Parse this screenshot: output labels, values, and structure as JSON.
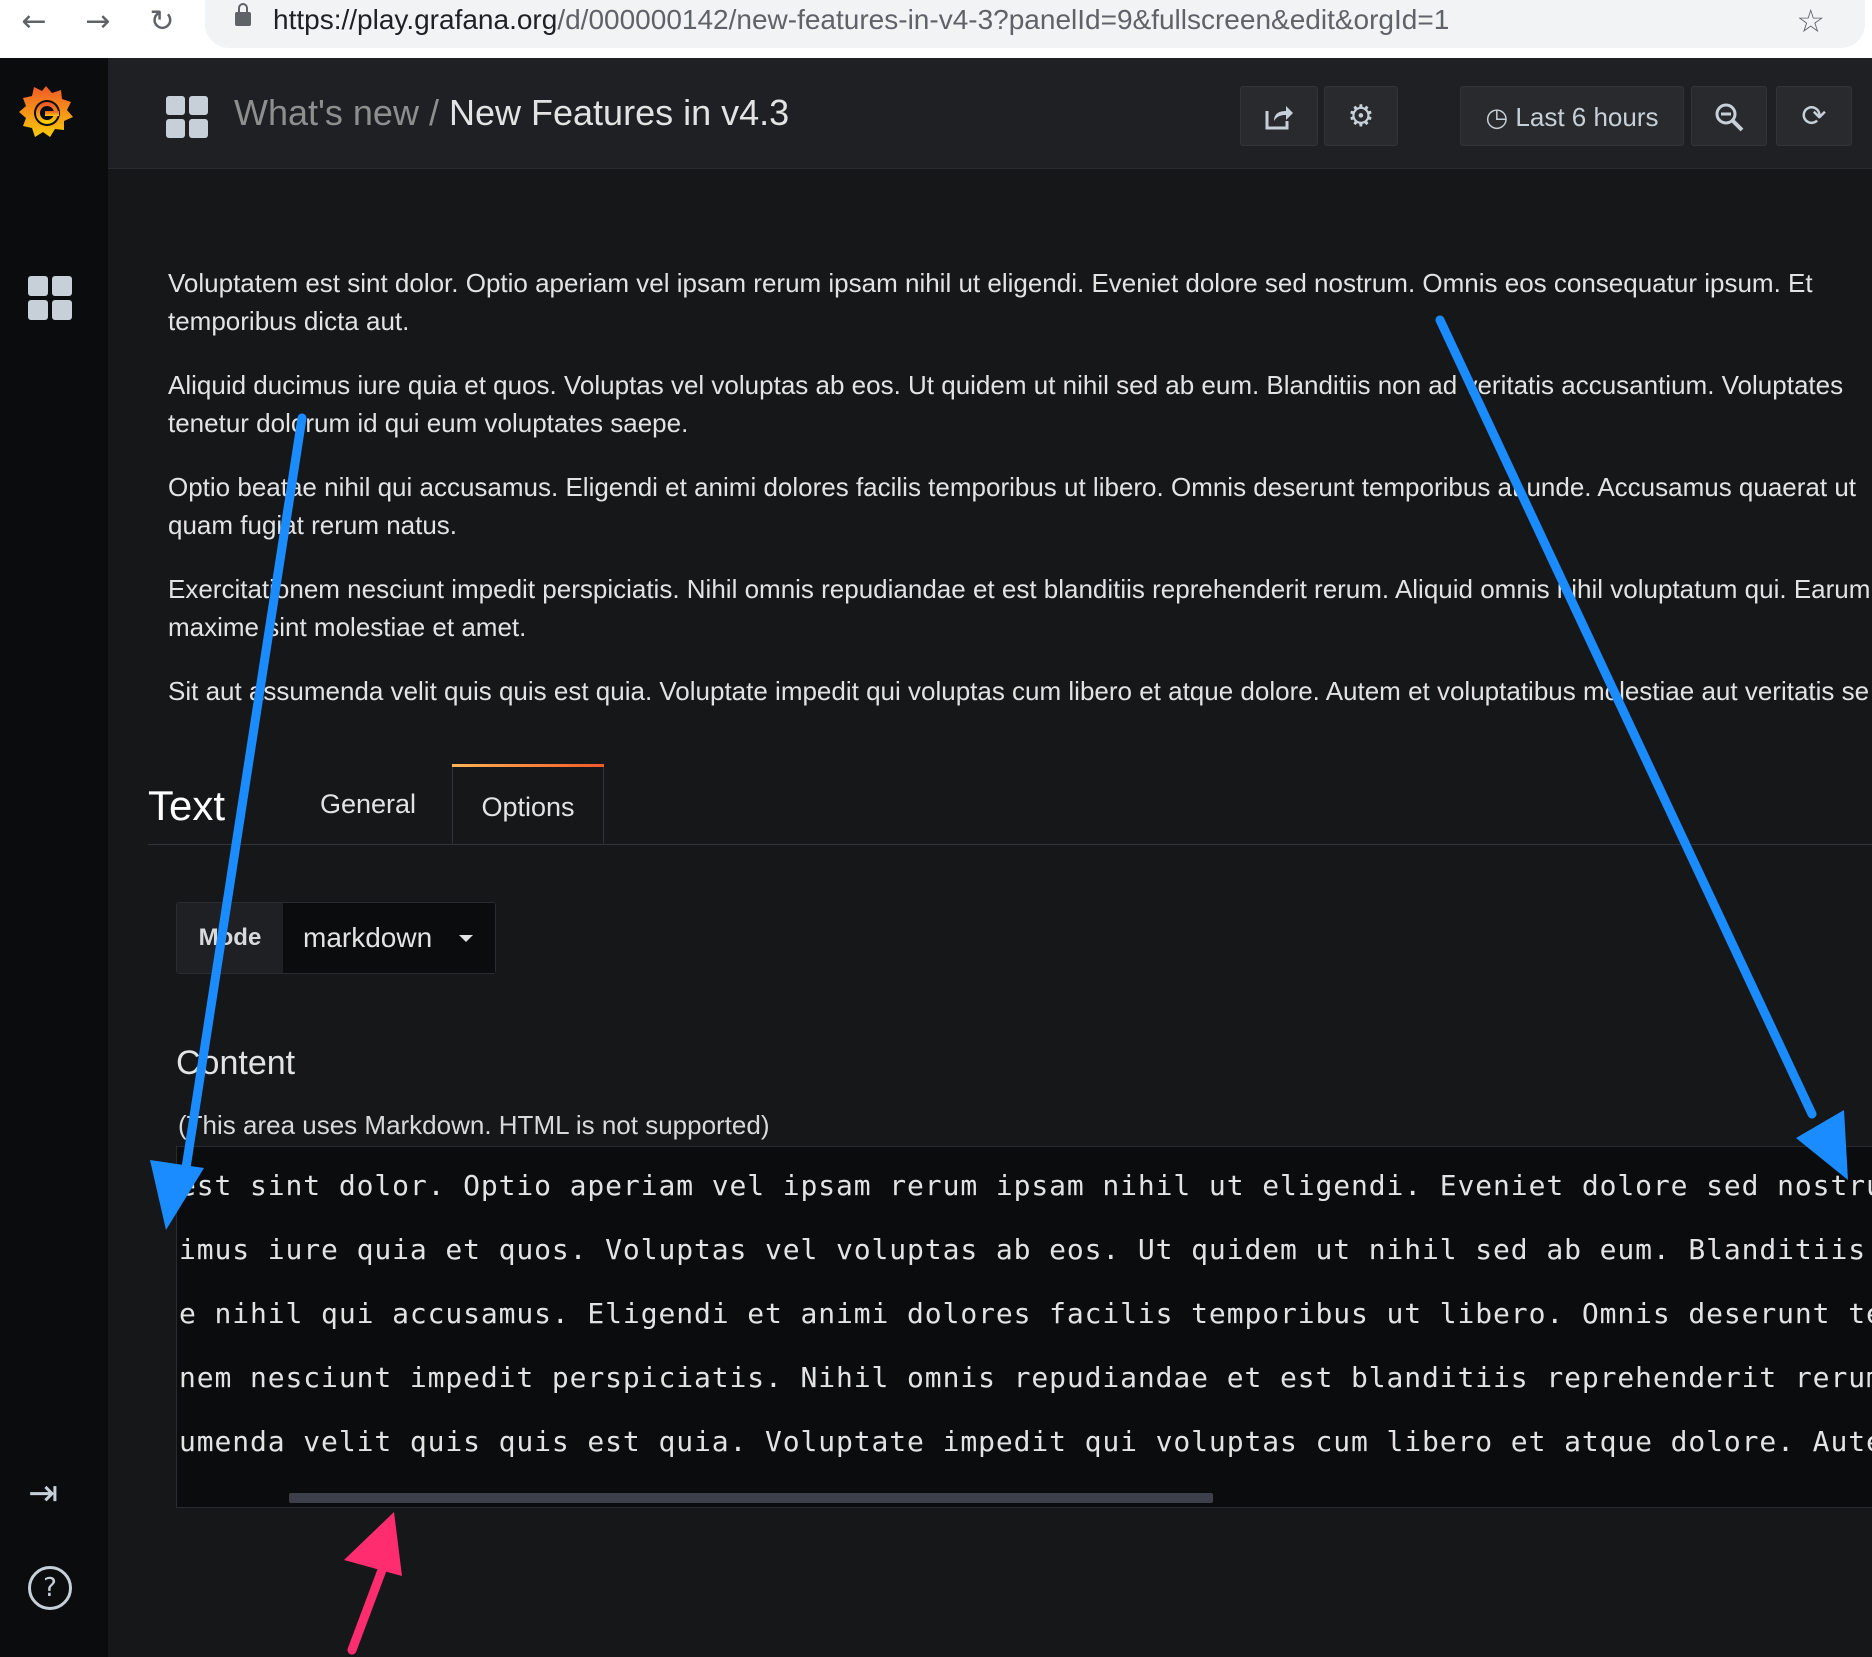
{
  "browser": {
    "url_host": "https://play.grafana.org",
    "url_path": "/d/000000142/new-features-in-v4-3?panelId=9&fullscreen&edit&orgId=1",
    "back_icon": "←",
    "forward_icon": "→",
    "reload_icon": "↻",
    "star_icon": "☆"
  },
  "navbar": {
    "folder": "What's new",
    "separator": "/",
    "title": "New Features in v4.3",
    "time_range": "Last 6 hours"
  },
  "panel": {
    "paragraphs": [
      "Voluptatem est sint dolor. Optio aperiam vel ipsam rerum ipsam nihil ut eligendi. Eveniet dolore sed nostrum. Omnis eos consequatur ipsum. Et",
      "temporibus dicta aut.",
      "Aliquid ducimus iure quia et quos. Voluptas vel voluptas ab eos. Ut quidem ut nihil sed ab eum. Blanditiis non ad veritatis accusantium. Voluptates",
      "tenetur dolorum id qui eum voluptates saepe.",
      "Optio beatae nihil qui accusamus. Eligendi et animi dolores facilis temporibus ut libero. Omnis deserunt temporibus at unde. Accusamus quaerat ut",
      "quam fugiat rerum natus.",
      "Exercitationem nesciunt impedit perspiciatis. Nihil omnis repudiandae et est blanditiis reprehenderit rerum. Aliquid omnis nihil voluptatum qui. Earum",
      "maxime sint molestiae et amet.",
      "Sit aut assumenda velit quis quis est quia. Voluptate impedit qui voluptas cum libero et atque dolore. Autem et voluptatibus molestiae aut veritatis se"
    ]
  },
  "editor": {
    "title": "Text",
    "tabs": [
      "General",
      "Options"
    ],
    "active_tab": "Options",
    "mode_label": "Mode",
    "mode_value": "markdown",
    "content_title": "Content",
    "content_hint": "(This area uses Markdown. HTML is not supported)",
    "code_lines": [
      "est sint dolor. Optio aperiam vel ipsam rerum ipsam nihil ut eligendi. Eveniet dolore sed nostrum. Om",
      "imus iure quia et quos. Voluptas vel voluptas ab eos. Ut quidem ut nihil sed ab eum. Blanditiis non a",
      "e nihil qui accusamus. Eligendi et animi dolores facilis temporibus ut libero. Omnis deserunt tempori",
      "nem nesciunt impedit perspiciatis. Nihil omnis repudiandae et est blanditiis reprehenderit rerum. Ali",
      "umenda velit quis quis est quia. Voluptate impedit qui voluptas cum libero et atque dolore. Autem et "
    ]
  },
  "colors": {
    "annotation_blue": "#1a8cff",
    "annotation_pink": "#ff2d6f",
    "tab_accent": "#f05a28",
    "grafana_orange": "#f46800"
  }
}
